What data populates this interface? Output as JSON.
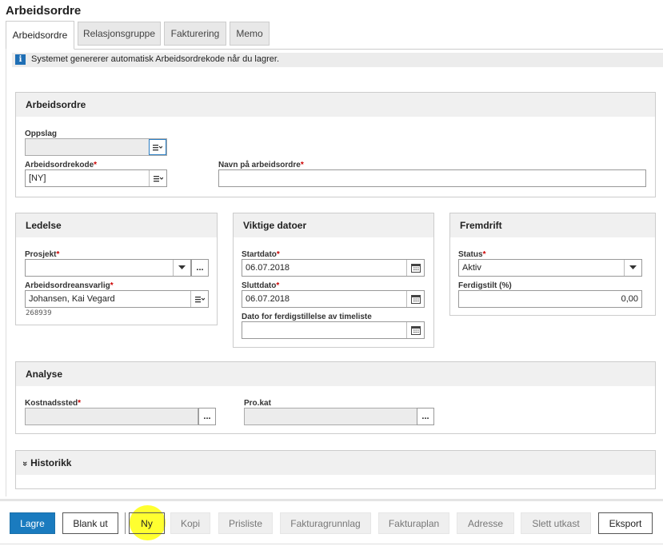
{
  "page": {
    "title": "Arbeidsordre"
  },
  "tabs": [
    {
      "label": "Arbeidsordre",
      "active": true
    },
    {
      "label": "Relasjonsgruppe",
      "active": false
    },
    {
      "label": "Fakturering",
      "active": false
    },
    {
      "label": "Memo",
      "active": false
    }
  ],
  "info": {
    "text": "Systemet genererer automatisk Arbeidsordrekode når du lagrer."
  },
  "arbeidsordre": {
    "title": "Arbeidsordre",
    "oppslag_label": "Oppslag",
    "oppslag_value": "",
    "kode_label": "Arbeidsordrekode",
    "kode_value": "[NY]",
    "navn_label": "Navn på arbeidsordre",
    "navn_value": ""
  },
  "ledelse": {
    "title": "Ledelse",
    "prosjekt_label": "Prosjekt",
    "prosjekt_value": "",
    "ansvarlig_label": "Arbeidsordreansvarlig",
    "ansvarlig_value": "Johansen, Kai Vegard",
    "ansvarlig_id": "268939"
  },
  "datoer": {
    "title": "Viktige datoer",
    "start_label": "Startdato",
    "start_value": "06.07.2018",
    "slutt_label": "Sluttdato",
    "slutt_value": "06.07.2018",
    "timeliste_label": "Dato for ferdigstillelse av timeliste",
    "timeliste_value": ""
  },
  "fremdrift": {
    "title": "Fremdrift",
    "status_label": "Status",
    "status_value": "Aktiv",
    "ferdig_label": "Ferdigstilt (%)",
    "ferdig_value": "0,00"
  },
  "analyse": {
    "title": "Analyse",
    "kostnadssted_label": "Kostnadssted",
    "kostnadssted_value": "",
    "prokat_label": "Pro.kat",
    "prokat_value": ""
  },
  "historikk": {
    "title": "Historikk",
    "chevron": "»"
  },
  "required_mark": "*",
  "ellipsis": "...",
  "footer": {
    "lagre": "Lagre",
    "blank_ut": "Blank ut",
    "ny": "Ny",
    "kopi": "Kopi",
    "prisliste": "Prisliste",
    "fakturagrunnlag": "Fakturagrunnlag",
    "fakturaplan": "Fakturaplan",
    "adresse": "Adresse",
    "slett_utkast": "Slett utkast",
    "eksport": "Eksport"
  },
  "colors": {
    "primary": "#1a7bbf",
    "highlight": "#ffff30",
    "required": "#cc0000",
    "info_icon": "#1f6fb5"
  }
}
